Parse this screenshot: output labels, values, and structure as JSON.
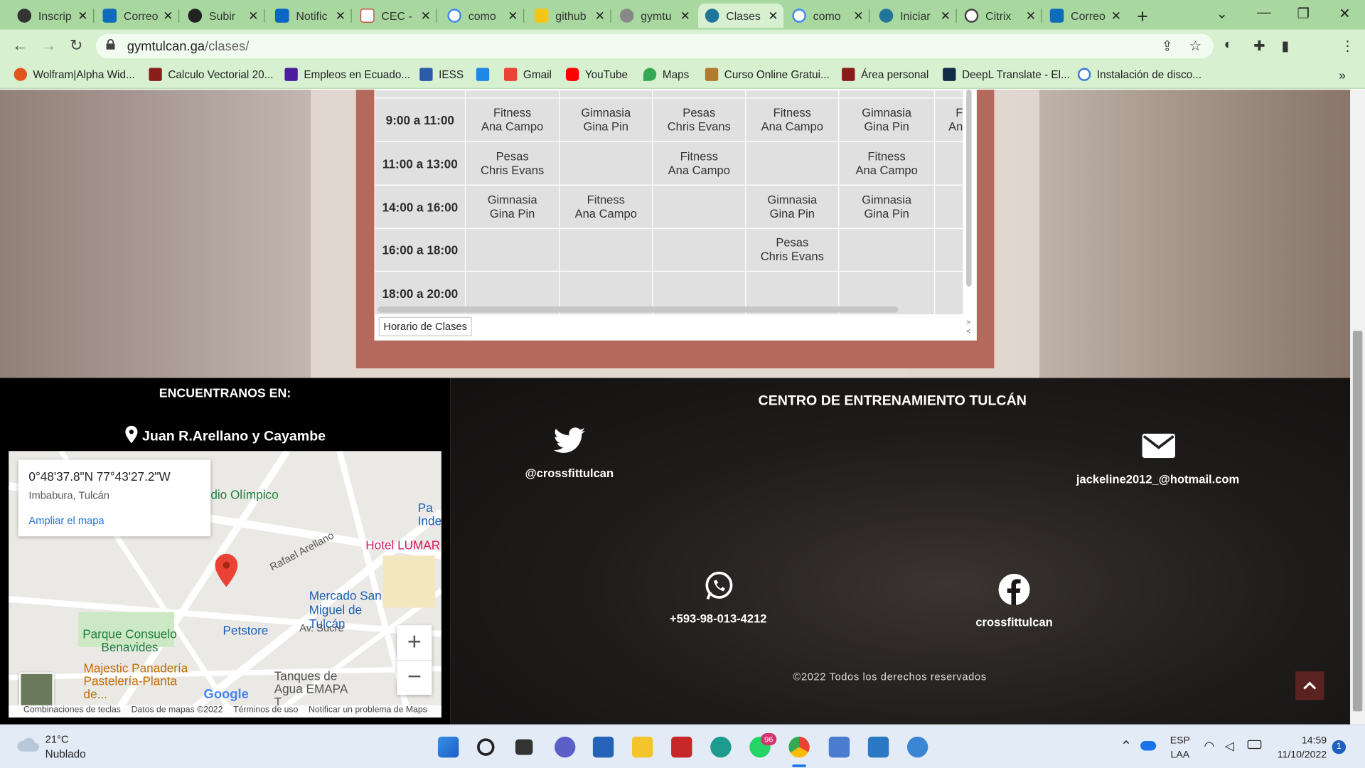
{
  "tabs": [
    "Inscrip",
    "Correo",
    "Subir",
    "Notific",
    "CEC -",
    "como",
    "github",
    "gymtu",
    "Clases",
    "como",
    "Iniciar",
    "Citrix",
    "Correo"
  ],
  "address": {
    "host": "gymtulcan.ga",
    "path": "/clases/"
  },
  "bookmarks": [
    "Wolfram|Alpha Wid...",
    "Calculo Vectorial 20...",
    "Empleos en Ecuado...",
    "IESS",
    "",
    "Gmail",
    "YouTube",
    "Maps",
    "Curso Online Gratui...",
    "Área personal",
    "DeepL Translate - El...",
    "Instalación de disco..."
  ],
  "schedule": {
    "sheet_tab": "Horario de Clases",
    "rows": [
      {
        "time": "9:00 a 11:00",
        "cells": [
          [
            "Fitness",
            "Ana Campo"
          ],
          [
            "Gimnasia",
            "Gina Pin"
          ],
          [
            "Pesas",
            "Chris Evans"
          ],
          [
            "Fitness",
            "Ana Campo"
          ],
          [
            "Gimnasia",
            "Gina Pin"
          ],
          [
            "F",
            "An"
          ]
        ]
      },
      {
        "time": "11:00 a 13:00",
        "cells": [
          [
            "Pesas",
            "Chris Evans"
          ],
          [],
          [
            "Fitness",
            "Ana Campo"
          ],
          [],
          [
            "Fitness",
            "Ana Campo"
          ],
          []
        ]
      },
      {
        "time": "14:00 a 16:00",
        "cells": [
          [
            "Gimnasia",
            "Gina Pin"
          ],
          [
            "Fitness",
            "Ana Campo"
          ],
          [],
          [
            "Gimnasia",
            "Gina Pin"
          ],
          [
            "Gimnasia",
            "Gina Pin"
          ],
          []
        ]
      },
      {
        "time": "16:00 a 18:00",
        "cells": [
          [],
          [],
          [],
          [
            "Pesas",
            "Chris Evans"
          ],
          [],
          []
        ]
      },
      {
        "time": "18:00 a 20:00",
        "cells": [
          [],
          [],
          [],
          [],
          [],
          []
        ]
      }
    ]
  },
  "footer": {
    "find_us": "ENCUENTRANOS EN:",
    "address": "Juan R.Arellano y Cayambe",
    "title": "CENTRO DE ENTRENAMIENTO TULCÁN",
    "twitter": "@crossfittulcan",
    "email": "jackeline2012_@hotmail.com",
    "phone": "+593-98-013-4212",
    "facebook": "crossfittulcan",
    "copyright": "©2022 Todos los derechos reservados"
  },
  "map": {
    "coords": "0°48'37.8\"N 77°43'27.2\"W",
    "location": "Imbabura, Tulcán",
    "enlarge": "Ampliar el mapa",
    "labels": [
      "dio Olímpico",
      "Hotel LUMAR",
      "Mercado San Miguel de Tulcán",
      "Petstore",
      "Parque Consuelo Benavides",
      "Majestic Panadería Pastelería-Planta de...",
      "Tanques de Agua EMAPA T",
      "Av. Sucre",
      "Rafael Arellano",
      "Pa Inde"
    ],
    "google": "Google",
    "attrib": [
      "Combinaciones de teclas",
      "Datos de mapas ©2022",
      "Términos de uso",
      "Notificar un problema de Maps"
    ]
  },
  "taskbar": {
    "temp": "21°C",
    "weather": "Nublado",
    "whatsapp_badge": "96",
    "lang1": "ESP",
    "lang2": "LAA",
    "time": "14:59",
    "date": "11/10/2022",
    "notifications": "1"
  }
}
